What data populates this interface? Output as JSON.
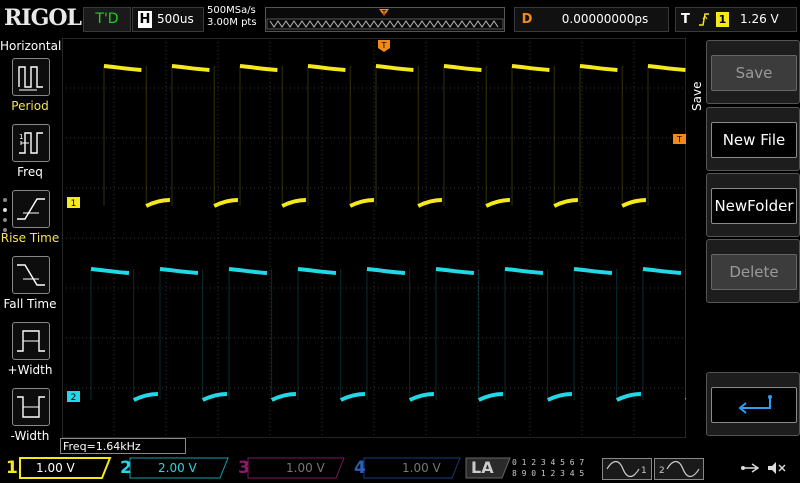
{
  "brand": "RIGOL",
  "top": {
    "trigger_status": "T'D",
    "horizontal_label": "H",
    "timebase": "500us",
    "sample_rate": "500MSa/s",
    "memory_depth": "3.00M pts",
    "delay_label": "D",
    "delay_value": "0.00000000ps",
    "trigger_label": "T",
    "trigger_source": "1",
    "trigger_level": "1.26 V"
  },
  "left_menu": {
    "title": "Horizontal",
    "items": [
      {
        "label": "Period",
        "icon": "period-icon"
      },
      {
        "label": "Freq",
        "icon": "freq-icon"
      },
      {
        "label": "Rise Time",
        "icon": "rise-time-icon"
      },
      {
        "label": "Fall Time",
        "icon": "fall-time-icon"
      },
      {
        "label": "+Width",
        "icon": "positive-width-icon"
      },
      {
        "label": "-Width",
        "icon": "negative-width-icon"
      }
    ]
  },
  "right_menu": {
    "title": "Save",
    "buttons": [
      {
        "label": "Save",
        "enabled": false
      },
      {
        "label": "New File",
        "enabled": true
      },
      {
        "label": "NewFolder",
        "enabled": true
      },
      {
        "label": "Delete",
        "enabled": false
      },
      {
        "label": "",
        "icon": "return-icon",
        "enabled": true
      }
    ]
  },
  "markers": {
    "ch1": "1",
    "ch2": "2",
    "trigger_pos": "T"
  },
  "measurement": "Freq=1.64kHz",
  "channels": [
    {
      "num": "1",
      "value": "1.00 V",
      "color": "#f5e81c",
      "active": true
    },
    {
      "num": "2",
      "value": "2.00 V",
      "color": "#22d8e6",
      "active": true
    },
    {
      "num": "3",
      "value": "1.00 V",
      "color": "#c0208c",
      "active": false
    },
    {
      "num": "4",
      "value": "1.00 V",
      "color": "#2a6fd6",
      "active": false
    }
  ],
  "bottom": {
    "la_label": "LA",
    "la_digits_top": "0 1 2 3   4 5 6 7",
    "la_digits_bot": "8 9 0 1   2 3 4 5",
    "gen1": "1",
    "gen2": "2"
  },
  "colors": {
    "ch1": "#f5e81c",
    "ch2": "#22d8e6",
    "trigger": "#f28a1a",
    "grid": "#3a3a3a"
  }
}
